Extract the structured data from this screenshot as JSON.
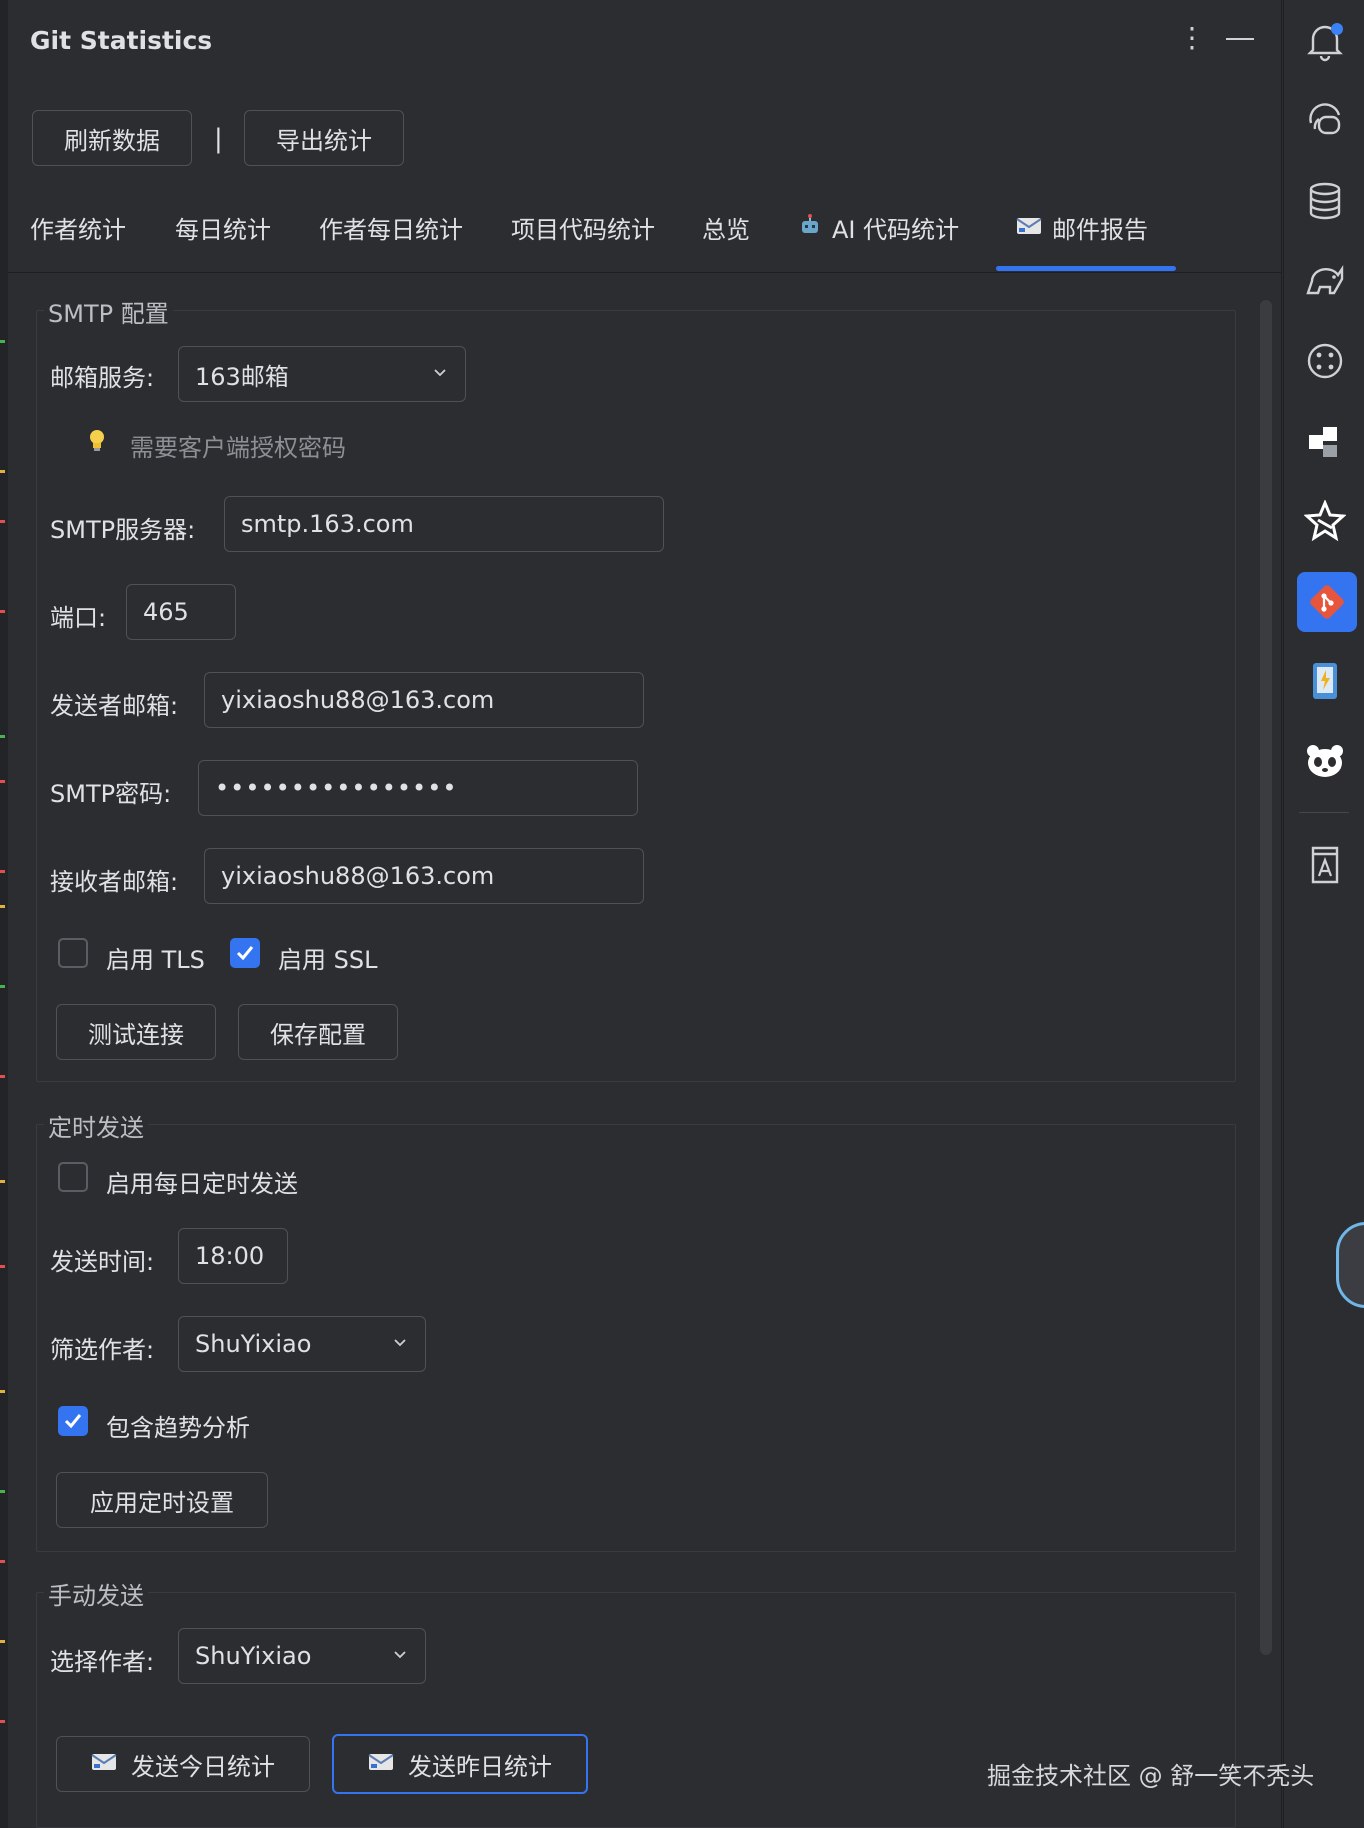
{
  "window": {
    "title": "Git Statistics"
  },
  "toolbar": {
    "refresh": "刷新数据",
    "separator": "|",
    "export": "导出统计"
  },
  "tabs": [
    {
      "label": "作者统计",
      "icon": ""
    },
    {
      "label": "每日统计",
      "icon": ""
    },
    {
      "label": "作者每日统计",
      "icon": ""
    },
    {
      "label": "项目代码统计",
      "icon": ""
    },
    {
      "label": "总览",
      "icon": ""
    },
    {
      "label": "AI 代码统计",
      "icon": "robot-icon"
    },
    {
      "label": "邮件报告",
      "icon": "email-icon",
      "selected": true
    }
  ],
  "smtp": {
    "legend": "SMTP 配置",
    "provider_label": "邮箱服务:",
    "provider_value": "163邮箱",
    "hint": "需要客户端授权密码",
    "server_label": "SMTP服务器:",
    "server_value": "smtp.163.com",
    "port_label": "端口:",
    "port_value": "465",
    "sender_label": "发送者邮箱:",
    "sender_value": "yixiaoshu88@163.com",
    "password_label": "SMTP密码:",
    "password_value": "••••••••••••••••",
    "receiver_label": "接收者邮箱:",
    "receiver_value": "yixiaoshu88@163.com",
    "tls_label": "启用 TLS",
    "tls_checked": false,
    "ssl_label": "启用 SSL",
    "ssl_checked": true,
    "test_button": "测试连接",
    "save_button": "保存配置"
  },
  "schedule": {
    "legend": "定时发送",
    "enable_label": "启用每日定时发送",
    "enable_checked": false,
    "time_label": "发送时间:",
    "time_value": "18:00",
    "author_label": "筛选作者:",
    "author_value": "ShuYixiao",
    "trend_label": "包含趋势分析",
    "trend_checked": true,
    "apply_button": "应用定时设置"
  },
  "manual": {
    "legend": "手动发送",
    "author_label": "选择作者:",
    "author_value": "ShuYixiao",
    "send_today": "发送今日统计",
    "send_yesterday": "发送昨日统计"
  },
  "watermark": "掘金技术社区 @ 舒一笑不秃头",
  "colors": {
    "accent": "#3574f0",
    "background": "#2b2d30",
    "text": "#dfe1e5",
    "border": "#4e5157",
    "notification_dot": "#3b82f6"
  }
}
